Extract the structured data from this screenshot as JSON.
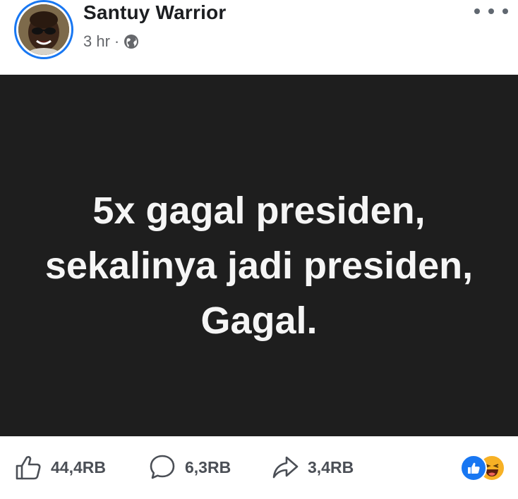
{
  "post": {
    "author": "Santuy Warrior",
    "time": "3 hr",
    "separator": "·",
    "privacy_icon": "globe-icon",
    "more_icon": "more-horizontal-icon",
    "content_text": "5x gagal presiden, sekalinya jadi presiden, Gagal.",
    "content_background": "#1e1e1e",
    "content_text_color": "#f5f5f5"
  },
  "footer": {
    "likes": "44,4RB",
    "comments": "6,3RB",
    "shares": "3,4RB",
    "reactions": [
      "like-reaction-icon",
      "haha-reaction-icon"
    ]
  },
  "colors": {
    "accent": "#1877f2",
    "text": "#1c1e21",
    "secondary_text": "#65676b",
    "haha": "#f7b125"
  }
}
